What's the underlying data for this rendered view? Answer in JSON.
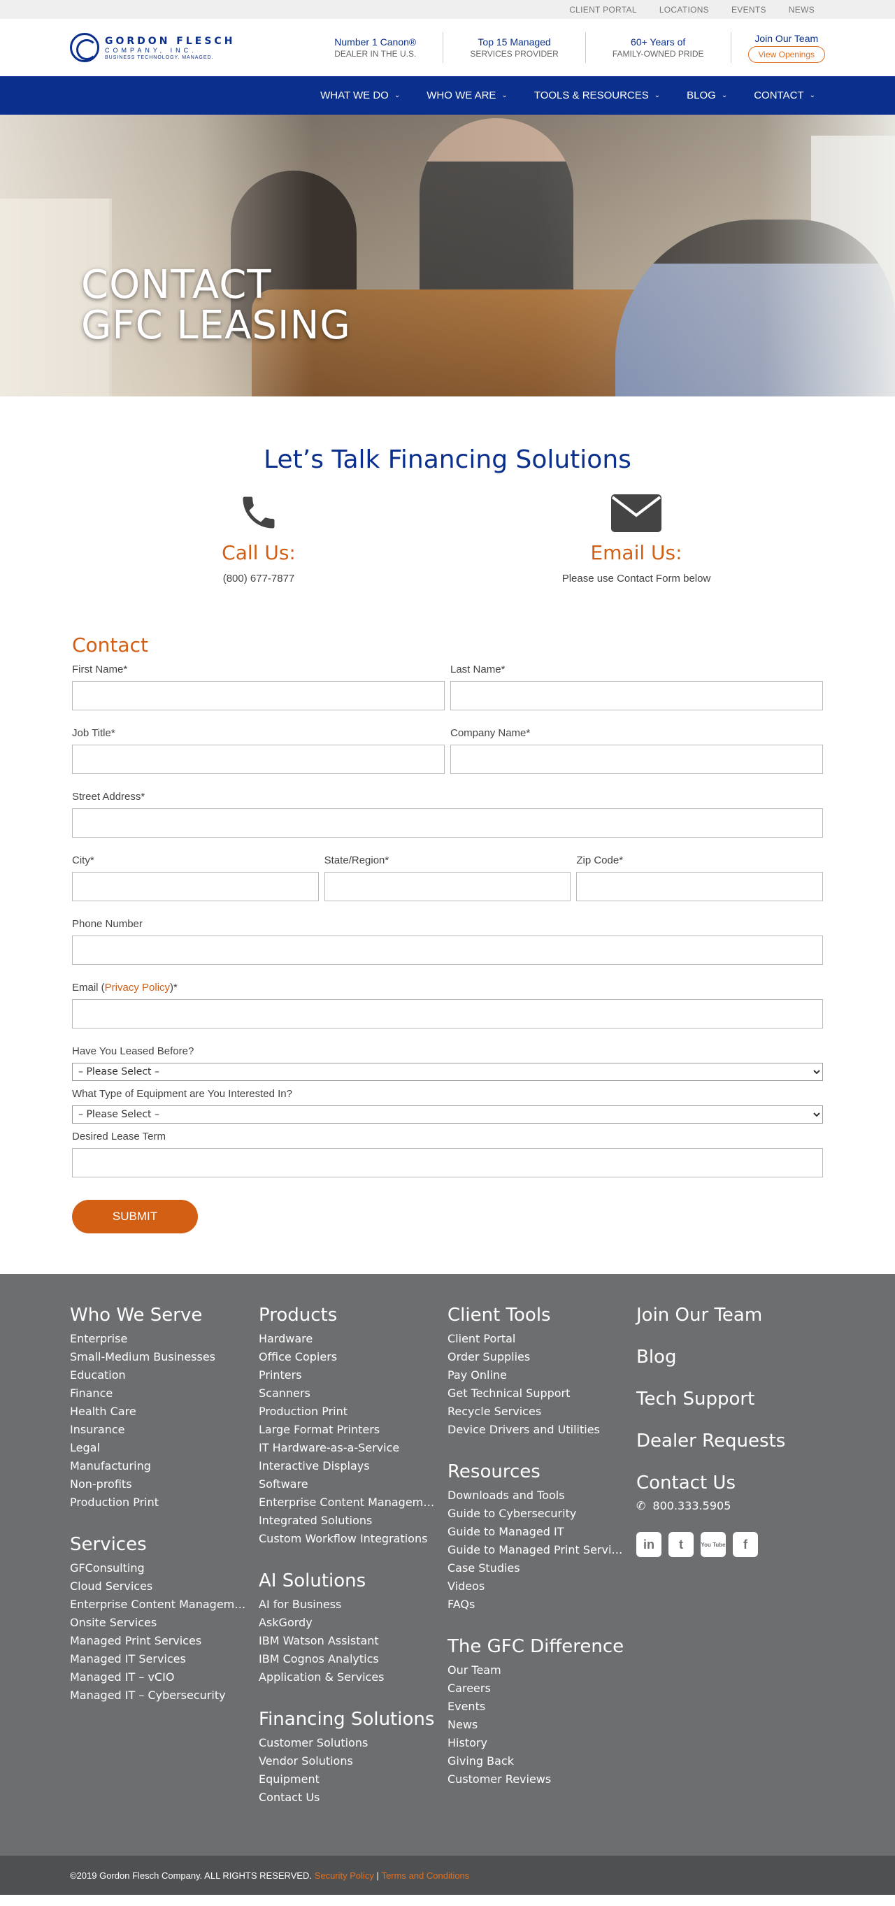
{
  "utility": [
    "CLIENT PORTAL",
    "LOCATIONS",
    "EVENTS",
    "NEWS"
  ],
  "logo": {
    "name": "GORDON FLESCH",
    "sub": "COMPANY, INC.",
    "tag": "BUSINESS TECHNOLOGY. MANAGED."
  },
  "stats": [
    {
      "top": "Number 1 Canon®",
      "bottom": "DEALER IN THE U.S."
    },
    {
      "top": "Top 15 Managed",
      "bottom": "SERVICES PROVIDER"
    },
    {
      "top": "60+ Years of",
      "bottom": "FAMILY-OWNED PRIDE"
    }
  ],
  "join": {
    "title": "Join Our Team",
    "button": "View Openings"
  },
  "nav": [
    "WHAT WE DO",
    "WHO WE ARE",
    "TOOLS & RESOURCES",
    "BLOG",
    "CONTACT"
  ],
  "hero": {
    "line1": "CONTACT",
    "line2": "GFC LEASING"
  },
  "talk": {
    "title": "Let’s Talk Financing Solutions",
    "call": {
      "heading": "Call Us:",
      "text": "(800) 677-7877"
    },
    "email": {
      "heading": "Email Us:",
      "text": "Please use Contact Form below"
    }
  },
  "form": {
    "title": "Contact",
    "first_name": "First Name*",
    "last_name": "Last Name*",
    "job_title": "Job Title*",
    "company": "Company Name*",
    "street": "Street Address*",
    "city": "City*",
    "state": "State/Region*",
    "zip": "Zip Code*",
    "phone": "Phone Number",
    "email_prefix": "Email (",
    "email_link": "Privacy Policy",
    "email_suffix": ")*",
    "leased_before": "Have You Leased Before?",
    "equipment": "What Type of Equipment are You Interested In?",
    "select_placeholder": "– Please Select –",
    "lease_term": "Desired Lease Term",
    "submit": "SUBMIT"
  },
  "footer": {
    "who_we_serve": {
      "title": "Who We Serve",
      "items": [
        "Enterprise",
        "Small-Medium Businesses",
        "Education",
        "Finance",
        "Health Care",
        "Insurance",
        "Legal",
        "Manufacturing",
        "Non-profits",
        "Production Print"
      ]
    },
    "services": {
      "title": "Services",
      "items": [
        "GFConsulting",
        "Cloud Services",
        "Enterprise Content Manageme...",
        "Onsite Services",
        "Managed Print Services",
        "Managed IT Services",
        "Managed IT – vCIO",
        "Managed IT – Cybersecurity"
      ]
    },
    "products": {
      "title": "Products",
      "items": [
        "Hardware",
        "Office Copiers",
        "Printers",
        "Scanners",
        "Production Print",
        "Large Format Printers",
        "IT Hardware-as-a-Service",
        "Interactive Displays",
        "Software",
        "Enterprise Content Manageme...",
        "Integrated Solutions",
        "Custom Workflow Integrations"
      ]
    },
    "ai": {
      "title": "AI Solutions",
      "items": [
        "AI for Business",
        "AskGordy",
        "IBM Watson Assistant",
        "IBM Cognos Analytics",
        "Application & Services"
      ]
    },
    "financing": {
      "title": "Financing Solutions",
      "items": [
        "Customer Solutions",
        "Vendor Solutions",
        "Equipment",
        "Contact Us"
      ]
    },
    "client_tools": {
      "title": "Client Tools",
      "items": [
        "Client Portal",
        "Order Supplies",
        "Pay Online",
        "Get Technical Support",
        "Recycle Services",
        "Device Drivers and Utilities"
      ]
    },
    "resources": {
      "title": "Resources",
      "items": [
        "Downloads and Tools",
        "Guide to Cybersecurity",
        "Guide to Managed IT",
        "Guide to Managed Print Servic...",
        "Case Studies",
        "Videos",
        "FAQs"
      ]
    },
    "gfc_difference": {
      "title": "The GFC Difference",
      "items": [
        "Our Team",
        "Careers",
        "Events",
        "News",
        "History",
        "Giving Back",
        "Customer Reviews"
      ]
    },
    "right": {
      "join": "Join Our Team",
      "blog": "Blog",
      "tech": "Tech Support",
      "dealer": "Dealer Requests",
      "contact": "Contact Us",
      "phone": "800.333.5905"
    },
    "socials": [
      "in",
      "t",
      "You Tube",
      "f"
    ]
  },
  "bottom": {
    "copy": "©2019 Gordon Flesch Company. ALL RIGHTS RESERVED.",
    "security": "Security Policy",
    "sep": "|",
    "terms": "Terms and Conditions"
  },
  "colors": {
    "brand_blue": "#0a2f8c",
    "accent_orange": "#d35f14",
    "footer_gray": "#6d6e70"
  }
}
